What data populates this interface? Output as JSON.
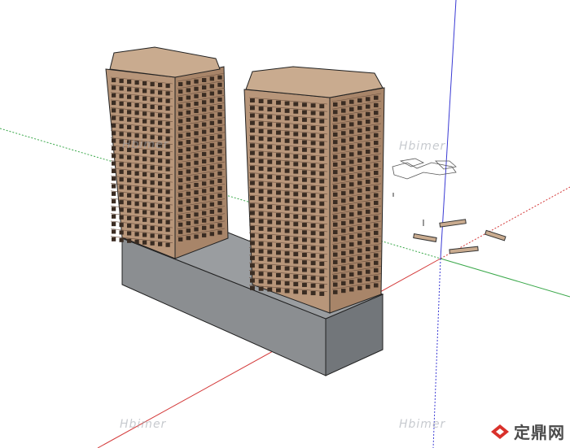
{
  "watermarks": {
    "mid_right": "Hbimer",
    "mid_left": "Hbimer",
    "bottom_left": "Hbimer",
    "bottom_right": "Hbimer"
  },
  "logo": {
    "text": "定鼎网",
    "color": "#d9312b"
  },
  "colors": {
    "axis_red": "#d43a3a",
    "axis_green": "#3aa84a",
    "axis_blue": "#3a3ad4",
    "facade": "#b8967a",
    "facade_dark": "#8c6b52",
    "podium": "#8a8d90"
  }
}
